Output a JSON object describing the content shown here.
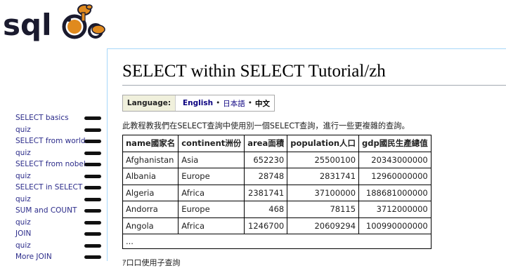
{
  "logo": {
    "text": "sql",
    "icon": "camel-mascot"
  },
  "sidebar": {
    "items": [
      {
        "label": "SELECT basics"
      },
      {
        "label": "quiz"
      },
      {
        "label": "SELECT from world"
      },
      {
        "label": "quiz"
      },
      {
        "label": "SELECT from nobel"
      },
      {
        "label": "quiz"
      },
      {
        "label": "SELECT in SELECT"
      },
      {
        "label": "quiz"
      },
      {
        "label": "SUM and COUNT"
      },
      {
        "label": "quiz"
      },
      {
        "label": "JOIN"
      },
      {
        "label": "quiz"
      },
      {
        "label": "More JOIN"
      }
    ]
  },
  "page": {
    "title": "SELECT within SELECT Tutorial/zh",
    "intro": "此教程教我們在SELECT查詢中使用別一個SELECT查詢，進行一些更複雜的查詢。",
    "next_line": "ｱ口口使用子查詢"
  },
  "language_bar": {
    "label": "Language:",
    "english": "English",
    "japanese": "日本語",
    "chinese": "中文",
    "separator": "•"
  },
  "table": {
    "headers": [
      "name國家名",
      "continent洲份",
      "area面積",
      "population人口",
      "gdp國民生產總值"
    ],
    "rows": [
      [
        "Afghanistan",
        "Asia",
        "652230",
        "25500100",
        "20343000000"
      ],
      [
        "Albania",
        "Europe",
        "28748",
        "2831741",
        "12960000000"
      ],
      [
        "Algeria",
        "Africa",
        "2381741",
        "37100000",
        "188681000000"
      ],
      [
        "Andorra",
        "Europe",
        "468",
        "78115",
        "3712000000"
      ],
      [
        "Angola",
        "Africa",
        "1246700",
        "20609294",
        "100990000000"
      ]
    ],
    "ellipsis": "..."
  },
  "colors": {
    "link": "#2b2b8a",
    "frame_border": "#a7d7f9",
    "lang_label_bg": "#f0f0dc",
    "logo_dark": "#1a1a2e",
    "logo_orange": "#e08a1e"
  }
}
